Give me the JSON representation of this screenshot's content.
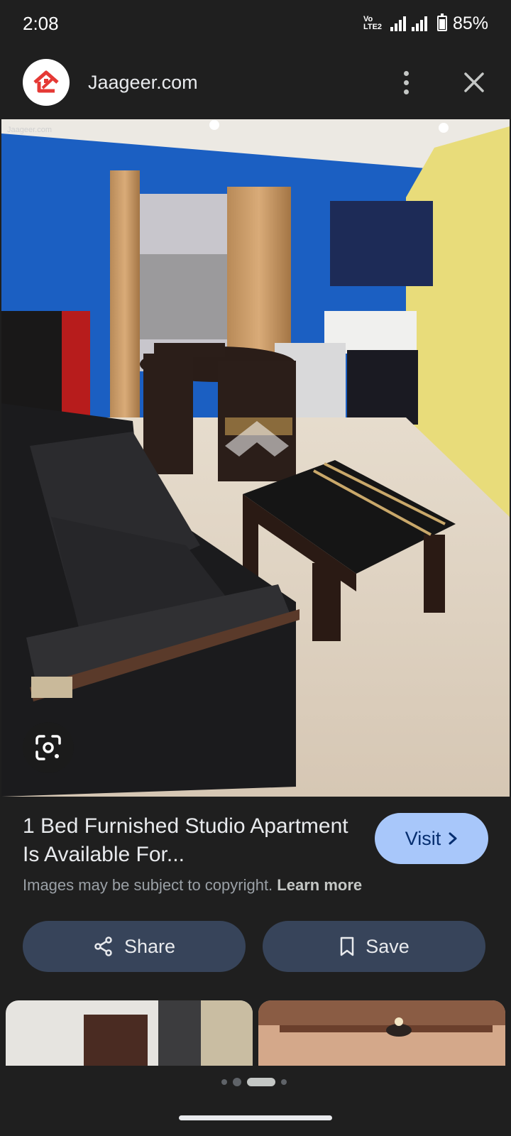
{
  "status_bar": {
    "time": "2:08",
    "network_top": "Vo LTE2",
    "network_type": "4G",
    "battery": "85%"
  },
  "header": {
    "site_name": "Jaageer.com",
    "icons": {
      "menu": "more-vert-icon",
      "close": "close-icon"
    }
  },
  "image": {
    "watermark": "Jaageer.com",
    "description_icons": {
      "lens": "lens-icon"
    }
  },
  "result": {
    "title": "1 Bed Furnished Studio Apartment Is Available For...",
    "visit_label": "Visit",
    "copyright_text": "Images may be subject to copyright.",
    "learn_more": "Learn more"
  },
  "actions": {
    "share_label": "Share",
    "save_label": "Save"
  },
  "colors": {
    "background": "#1f1f1f",
    "visit_button": "#a8c7fa",
    "action_button": "#37445a",
    "logo_red": "#e53935"
  }
}
